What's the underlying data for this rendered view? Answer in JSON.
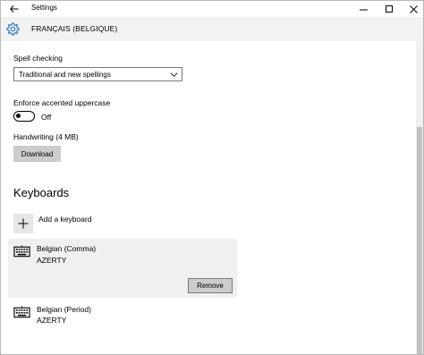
{
  "window": {
    "title": "Settings",
    "icons": {
      "back": "back-arrow-icon",
      "minimize": "minimize-icon",
      "maximize": "maximize-icon",
      "close": "close-icon"
    }
  },
  "header": {
    "icon": "gear-icon",
    "title": "FRANÇAIS (BELGIQUE)"
  },
  "spell_checking": {
    "label": "Spell checking",
    "selected": "Traditional and new spellings"
  },
  "enforce_accented": {
    "label": "Enforce accented uppercase",
    "state_text": "Off",
    "on": false
  },
  "handwriting": {
    "label": "Handwriting (4 MB)",
    "button": "Download"
  },
  "keyboards": {
    "title": "Keyboards",
    "add_label": "Add a keyboard",
    "items": [
      {
        "name": "Belgian (Comma)",
        "layout": "AZERTY",
        "selected": true,
        "action": "Remove",
        "icon": "keyboard-icon"
      },
      {
        "name": "Belgian (Period)",
        "layout": "AZERTY",
        "selected": false,
        "icon": "keyboard-icon"
      }
    ]
  },
  "colors": {
    "accent": "#2b77c9",
    "header_bg": "#f2f2f2",
    "button_bg": "#cccccc",
    "selected_bg": "#f0f0f0"
  }
}
